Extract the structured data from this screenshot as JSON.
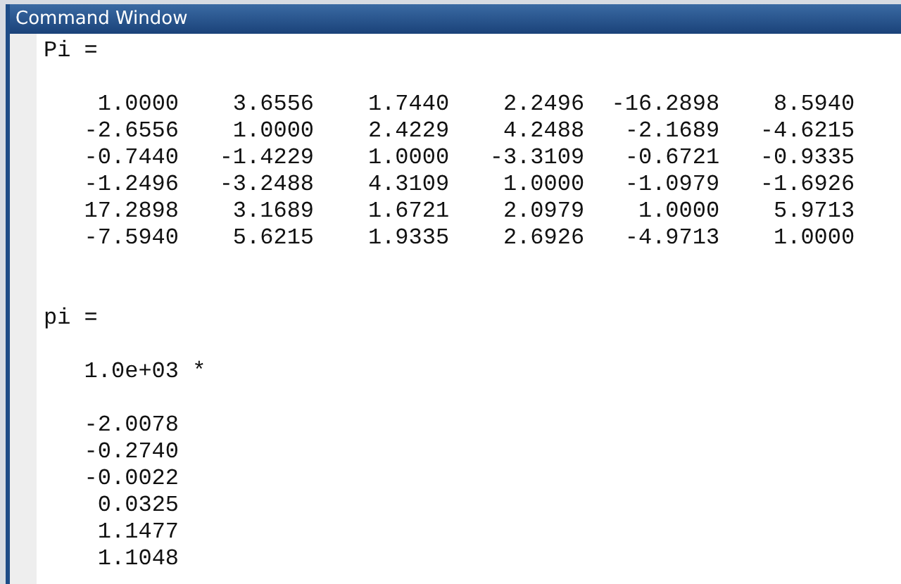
{
  "window": {
    "title": "Command Window"
  },
  "outputs": [
    {
      "kind": "matrix",
      "name": "Pi =",
      "rows": [
        [
          "1.0000",
          "3.6556",
          "1.7440",
          "2.2496",
          "-16.2898",
          "8.5940"
        ],
        [
          "-2.6556",
          "1.0000",
          "2.4229",
          "4.2488",
          "-2.1689",
          "-4.6215"
        ],
        [
          "-0.7440",
          "-1.4229",
          "1.0000",
          "-3.3109",
          "-0.6721",
          "-0.9335"
        ],
        [
          "-1.2496",
          "-3.2488",
          "4.3109",
          "1.0000",
          "-1.0979",
          "-1.6926"
        ],
        [
          "17.2898",
          "3.1689",
          "1.6721",
          "2.0979",
          "1.0000",
          "5.9713"
        ],
        [
          "-7.5940",
          "5.6215",
          "1.9335",
          "2.6926",
          "-4.9713",
          "1.0000"
        ]
      ]
    },
    {
      "kind": "scaled_vector",
      "name": "pi =",
      "scale": "1.0e+03 *",
      "values": [
        "-2.0078",
        "-0.2740",
        "-0.0022",
        "0.0325",
        "1.1477",
        "1.1048"
      ]
    }
  ]
}
